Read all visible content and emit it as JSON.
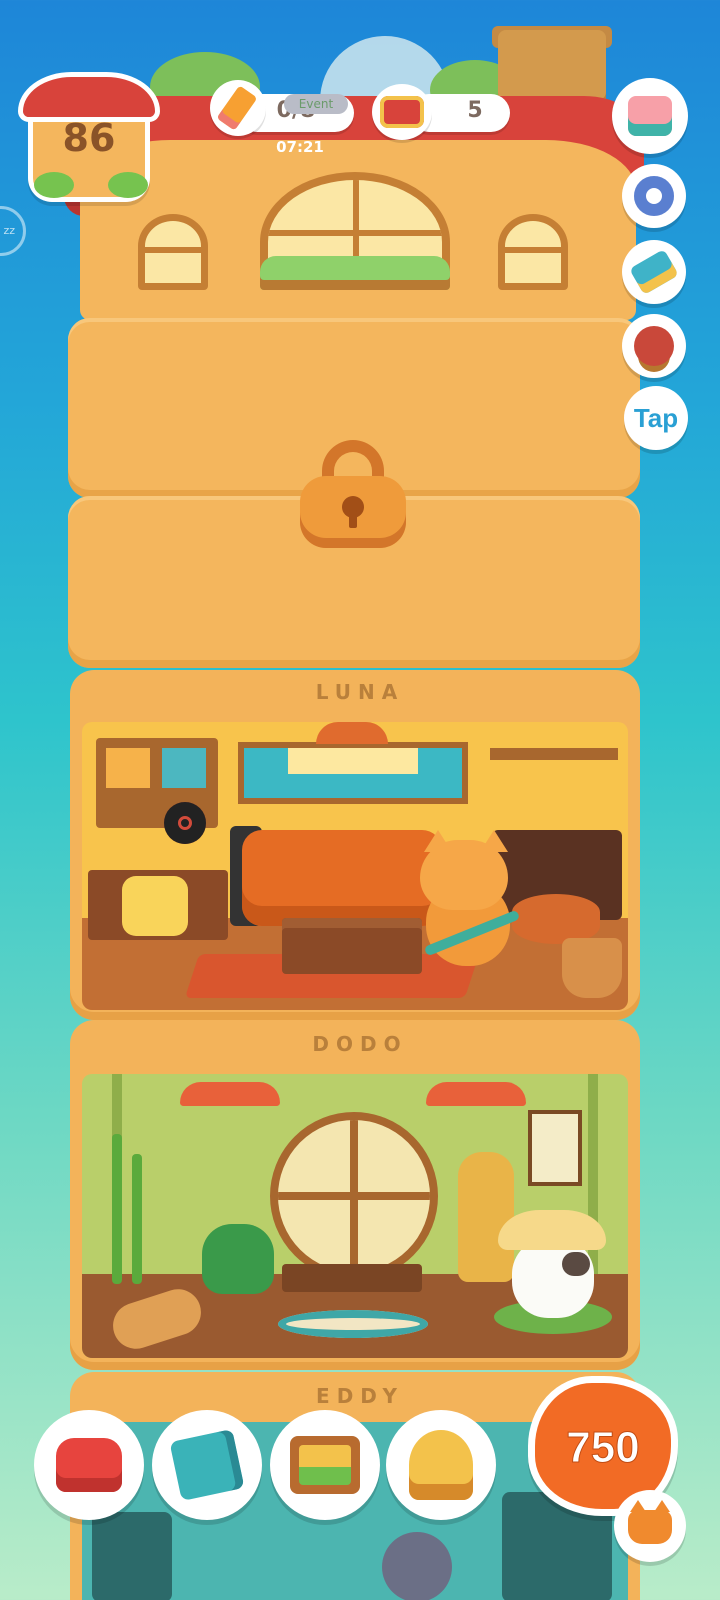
{
  "hud": {
    "level": "86",
    "pencil_count": "0/8",
    "pencil_tag": "Event",
    "timer": "07:21",
    "can_count": "5",
    "sleep_chip": "zz"
  },
  "side_buttons": {
    "tap_label": "Tap"
  },
  "floors": {
    "luna": "LUNA",
    "dodo": "DODO",
    "eddy": "EDDY"
  },
  "currency": {
    "coins": "750"
  },
  "icons": {
    "gift": "gift-icon",
    "settings": "gear-icon",
    "decorate": "paint-roller-icon",
    "stamp": "stamp-icon",
    "furniture": "armchair-icon",
    "catalog": "paw-book-icon",
    "album": "picture-frame-icon",
    "trophy": "trophy-icon",
    "cat": "cat-face-icon",
    "lock": "lock-icon"
  },
  "colors": {
    "roof": "#d8433b",
    "wall": "#f4b65d",
    "coin_blob": "#f26b25",
    "tap_text": "#2aa0d4"
  }
}
